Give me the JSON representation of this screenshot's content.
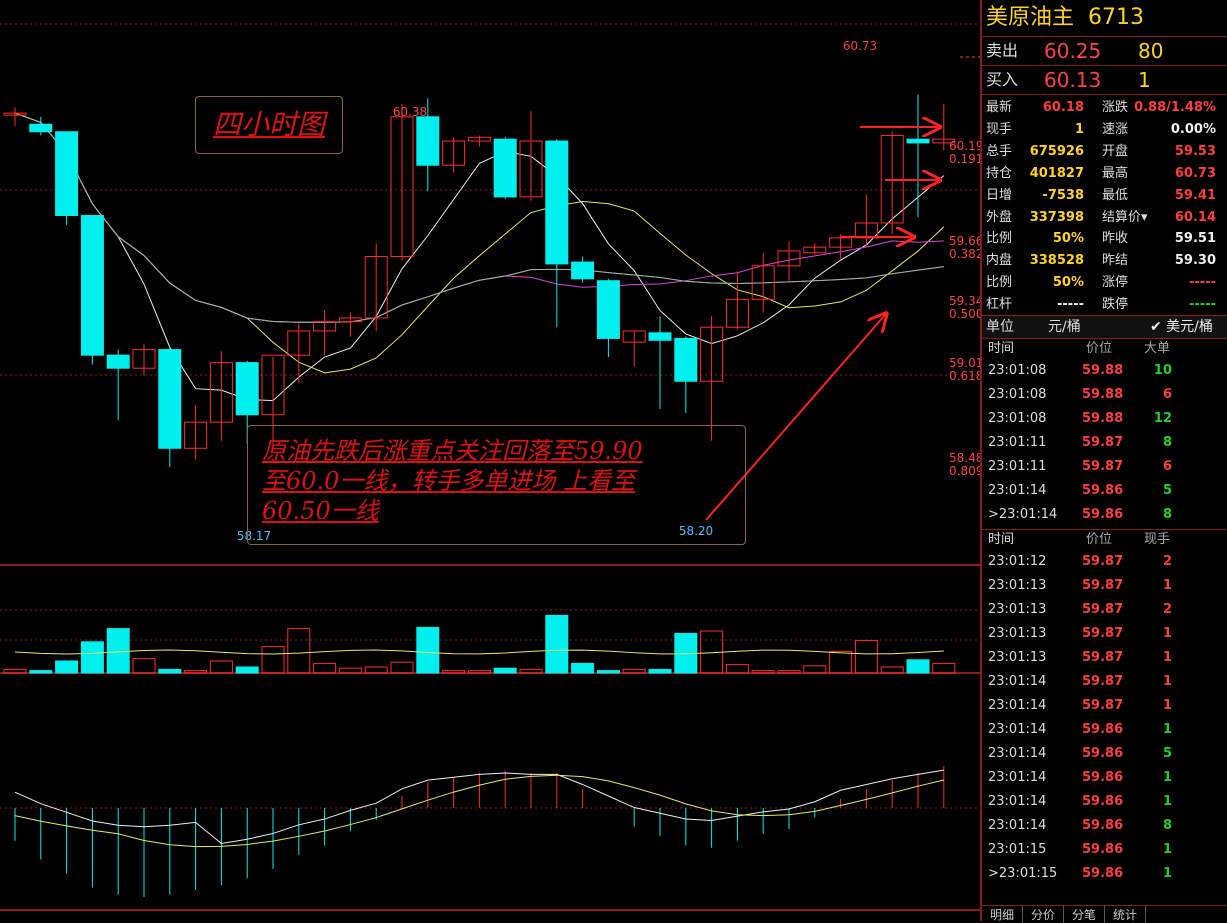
{
  "chart": {
    "title_box": "四小时图",
    "annotation_lines": [
      "原油先跌后涨重点关注回落至59.90",
      "至60.0一线，转手多单进场 上看至",
      "60.50一线"
    ],
    "high_label": "60.73",
    "high_label2": "60.38",
    "low_label1": "58.17",
    "low_label2": "58.20",
    "levels": [
      {
        "price": "60.19",
        "ratio": "0.191"
      },
      {
        "price": "59.66",
        "ratio": "0.382"
      },
      {
        "price": "59.34",
        "ratio": "0.500"
      },
      {
        "price": "59.01",
        "ratio": "0.618"
      },
      {
        "price": "58.48",
        "ratio": "0.809"
      }
    ],
    "colors": {
      "up": "#ff2a2a",
      "down": "#00f0f0",
      "grid": "#8b1a1a",
      "annotation": "#e01010"
    }
  },
  "panel": {
    "instrument": "美原油主",
    "code": "6713",
    "sell_label": "卖出",
    "sell_price": "60.25",
    "sell_qty": "80",
    "buy_label": "买入",
    "buy_price": "60.13",
    "buy_qty": "1",
    "stats": [
      {
        "l": "最新",
        "v": "60.18",
        "c": "red",
        "l2": "涨跌",
        "v2": "0.88/1.48%",
        "c2": "red"
      },
      {
        "l": "现手",
        "v": "1",
        "c": "yel",
        "l2": "速涨",
        "v2": "0.00%",
        "c2": "wht"
      },
      {
        "l": "总手",
        "v": "675926",
        "c": "yel",
        "l2": "开盘",
        "v2": "59.53",
        "c2": "red"
      },
      {
        "l": "持仓",
        "v": "401827",
        "c": "yel",
        "l2": "最高",
        "v2": "60.73",
        "c2": "red"
      },
      {
        "l": "日增",
        "v": "-7538",
        "c": "yel",
        "l2": "最低",
        "v2": "59.41",
        "c2": "red"
      },
      {
        "l": "外盘",
        "v": "337398",
        "c": "yel",
        "l2": "结算价▾",
        "v2": "60.14",
        "c2": "red"
      },
      {
        "l": "比例",
        "v": "50%",
        "c": "yel",
        "l2": "昨收",
        "v2": "59.51",
        "c2": "wht"
      },
      {
        "l": "内盘",
        "v": "338528",
        "c": "yel",
        "l2": "昨结",
        "v2": "59.30",
        "c2": "wht"
      },
      {
        "l": "比例",
        "v": "50%",
        "c": "yel",
        "l2": "涨停",
        "v2": "-----",
        "c2": "red"
      },
      {
        "l": "杠杆",
        "v": "-----",
        "c": "wht",
        "l2": "跌停",
        "v2": "-----",
        "c2": "grn"
      }
    ],
    "unit_label": "单位",
    "unit_value": "元/桶",
    "unit_check": "✔ 美元/桶",
    "big_header": [
      "时间",
      "价位",
      "大单"
    ],
    "big_orders": [
      {
        "t": "23:01:08",
        "p": "59.88",
        "v": "10",
        "c": "grn"
      },
      {
        "t": "23:01:08",
        "p": "59.88",
        "v": "6",
        "c": "red"
      },
      {
        "t": "23:01:08",
        "p": "59.88",
        "v": "12",
        "c": "grn"
      },
      {
        "t": "23:01:11",
        "p": "59.87",
        "v": "8",
        "c": "grn"
      },
      {
        "t": "23:01:11",
        "p": "59.87",
        "v": "6",
        "c": "red"
      },
      {
        "t": "23:01:14",
        "p": "59.86",
        "v": "5",
        "c": "grn"
      },
      {
        "t": ">23:01:14",
        "p": "59.86",
        "v": "8",
        "c": "grn"
      }
    ],
    "tick_header": [
      "时间",
      "价位",
      "现手"
    ],
    "ticks": [
      {
        "t": "23:01:12",
        "p": "59.87",
        "v": "2",
        "c": "red"
      },
      {
        "t": "23:01:13",
        "p": "59.87",
        "v": "1",
        "c": "red"
      },
      {
        "t": "23:01:13",
        "p": "59.87",
        "v": "2",
        "c": "red"
      },
      {
        "t": "23:01:13",
        "p": "59.87",
        "v": "1",
        "c": "red"
      },
      {
        "t": "23:01:13",
        "p": "59.87",
        "v": "1",
        "c": "red"
      },
      {
        "t": "23:01:14",
        "p": "59.87",
        "v": "1",
        "c": "red"
      },
      {
        "t": "23:01:14",
        "p": "59.87",
        "v": "1",
        "c": "red"
      },
      {
        "t": "23:01:14",
        "p": "59.86",
        "v": "1",
        "c": "grn"
      },
      {
        "t": "23:01:14",
        "p": "59.86",
        "v": "5",
        "c": "grn"
      },
      {
        "t": "23:01:14",
        "p": "59.86",
        "v": "1",
        "c": "grn"
      },
      {
        "t": "23:01:14",
        "p": "59.86",
        "v": "1",
        "c": "grn"
      },
      {
        "t": "23:01:14",
        "p": "59.86",
        "v": "8",
        "c": "grn"
      },
      {
        "t": "23:01:15",
        "p": "59.86",
        "v": "1",
        "c": "grn"
      },
      {
        "t": ">23:01:15",
        "p": "59.86",
        "v": "1",
        "c": "grn"
      }
    ],
    "tabs": [
      "明细",
      "分价",
      "分笔",
      "统计"
    ]
  },
  "chart_data": {
    "type": "candlestick",
    "ohlc": [
      [
        60.3,
        60.33,
        60.23,
        60.3
      ],
      [
        60.24,
        60.28,
        60.18,
        60.2
      ],
      [
        60.2,
        60.2,
        59.7,
        59.75
      ],
      [
        59.75,
        59.75,
        58.95,
        59.0
      ],
      [
        59.0,
        59.03,
        58.65,
        58.93
      ],
      [
        58.93,
        59.06,
        58.89,
        59.03
      ],
      [
        59.03,
        59.05,
        58.4,
        58.5
      ],
      [
        58.5,
        58.73,
        58.44,
        58.64
      ],
      [
        58.64,
        59.02,
        58.54,
        58.96
      ],
      [
        58.96,
        58.97,
        58.52,
        58.68
      ],
      [
        58.68,
        58.99,
        58.52,
        59.0
      ],
      [
        59.0,
        59.17,
        58.85,
        59.13
      ],
      [
        59.13,
        59.24,
        59.0,
        59.18
      ],
      [
        59.18,
        59.23,
        59.1,
        59.2
      ],
      [
        59.2,
        59.6,
        59.13,
        59.53
      ],
      [
        59.53,
        60.35,
        59.51,
        60.28
      ],
      [
        60.28,
        60.38,
        59.88,
        60.02
      ],
      [
        60.02,
        60.17,
        59.98,
        60.15
      ],
      [
        60.15,
        60.18,
        60.12,
        60.17
      ],
      [
        60.16,
        60.17,
        59.84,
        59.85
      ],
      [
        59.85,
        60.31,
        59.83,
        60.15
      ],
      [
        60.15,
        60.16,
        59.15,
        59.49
      ],
      [
        59.5,
        59.53,
        59.39,
        59.41
      ],
      [
        59.4,
        59.41,
        58.99,
        59.09
      ],
      [
        59.07,
        59.13,
        58.94,
        59.13
      ],
      [
        59.12,
        59.21,
        58.71,
        59.08
      ],
      [
        59.09,
        59.1,
        58.69,
        58.86
      ],
      [
        58.86,
        59.21,
        58.54,
        59.15
      ],
      [
        59.15,
        59.45,
        59.14,
        59.3
      ],
      [
        59.3,
        59.55,
        59.23,
        59.48
      ],
      [
        59.48,
        59.61,
        59.4,
        59.56
      ],
      [
        59.55,
        59.6,
        59.54,
        59.58
      ],
      [
        59.58,
        59.65,
        59.52,
        59.63
      ],
      [
        59.63,
        59.86,
        59.59,
        59.71
      ],
      [
        59.71,
        60.2,
        59.65,
        60.18
      ],
      [
        60.16,
        60.4,
        59.74,
        60.14
      ],
      [
        60.14,
        60.35,
        60.1,
        60.16
      ]
    ],
    "volume": [
      0.3,
      0.2,
      1.0,
      2.6,
      3.7,
      1.2,
      0.3,
      0.2,
      1.0,
      0.5,
      2.2,
      3.7,
      0.8,
      0.4,
      0.5,
      0.9,
      3.8,
      0.2,
      0.2,
      0.4,
      0.3,
      4.8,
      0.8,
      0.2,
      0.3,
      0.3,
      3.3,
      3.5,
      0.7,
      0.2,
      0.2,
      0.6,
      1.8,
      2.7,
      0.5,
      1.1,
      0.8
    ],
    "macd": [
      -1.4,
      -2.2,
      -2.8,
      -3.4,
      -3.7,
      -3.8,
      -3.7,
      -3.5,
      -3.3,
      -3.0,
      -2.6,
      -2.0,
      -1.6,
      -1.0,
      -0.5,
      0.5,
      1.1,
      1.3,
      1.5,
      1.6,
      1.5,
      1.5,
      0.8,
      0.0,
      -0.8,
      -1.2,
      -1.6,
      -1.7,
      -1.4,
      -1.1,
      -0.9,
      -0.4,
      0.4,
      0.8,
      1.2,
      1.5,
      1.8
    ],
    "ylim": [
      57.9,
      60.8
    ]
  }
}
